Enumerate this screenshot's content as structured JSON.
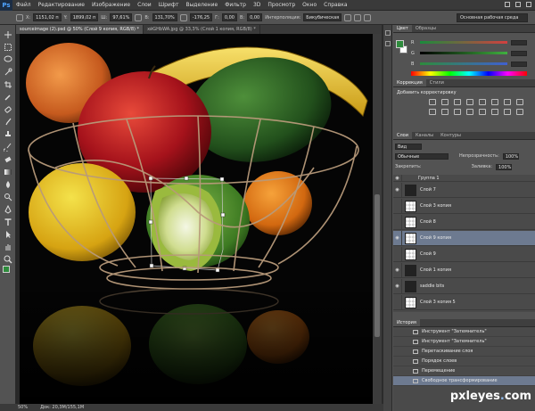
{
  "app": {
    "logo": "Ps"
  },
  "menu": [
    "Файл",
    "Редактирование",
    "Изображение",
    "Слои",
    "Шрифт",
    "Выделение",
    "Фильтр",
    "3D",
    "Просмотр",
    "Окно",
    "Справка"
  ],
  "options": {
    "x_label": "X:",
    "x_value": "1151,02 п",
    "y_label": "Y:",
    "y_value": "1899,02 п",
    "w_label": "Ш:",
    "w_value": "97,61%",
    "h_label": "В:",
    "h_value": "131,70%",
    "angle_value": "-176,25",
    "hskew_label": "Г:",
    "hskew_value": "0,00",
    "vskew_label": "В:",
    "vskew_value": "0,00",
    "interp_label": "Интерполяция:",
    "interp_value": "Бикубическая",
    "workspace": "Основная рабочая среда"
  },
  "tabs": [
    {
      "label": "sourceimage (2).psd @ 50% (Слой 9 копия, RGB/8) *",
      "active": true
    },
    {
      "label": "хйGНbWA.jpg @ 33,3% (Слой 1 копия, RGB/8) *",
      "active": false
    }
  ],
  "status": {
    "zoom": "50%",
    "doc": "Док: 20,3M/155,1M"
  },
  "color_panel": {
    "tabs": [
      "Цвет",
      "Образцы"
    ],
    "channels": [
      {
        "label": "R",
        "value": "",
        "color": "#d24040"
      },
      {
        "label": "G",
        "value": "",
        "color": "#40b040"
      },
      {
        "label": "B",
        "value": "",
        "color": "#4060d0"
      }
    ],
    "fg_color": "#2e8b3c",
    "bg_color": "#ffffff"
  },
  "adjustments": {
    "tabs": [
      "Коррекция",
      "Стили"
    ],
    "title": "Добавить корректировку"
  },
  "layers_panel": {
    "tabs": [
      "Слои",
      "Каналы",
      "Контуры"
    ],
    "kind_label": "Вид",
    "blend_mode": "Обычные",
    "opacity_label": "Непрозрачность:",
    "opacity_value": "100%",
    "lock_label": "Закрепить:",
    "fill_label": "Заливка:",
    "fill_value": "100%",
    "layers": [
      {
        "name": "Группа 1",
        "type": "group",
        "visible": true
      },
      {
        "name": "Слой 7",
        "visible": true,
        "thumb": "dark"
      },
      {
        "name": "Слой 3 копия",
        "visible": false,
        "thumb": "trans"
      },
      {
        "name": "Слой 8",
        "visible": false,
        "thumb": "trans"
      },
      {
        "name": "Слой 9 копия",
        "visible": true,
        "thumb": "trans",
        "selected": true
      },
      {
        "name": "Слой 9",
        "visible": false,
        "thumb": "trans"
      },
      {
        "name": "Слой 1 копия",
        "visible": true,
        "thumb": "dark"
      },
      {
        "name": "saddle bits",
        "visible": true,
        "thumb": "dark"
      },
      {
        "name": "Слой 3 копия 5",
        "visible": false,
        "thumb": "trans"
      }
    ]
  },
  "history": {
    "tabs": [
      "История"
    ],
    "items": [
      {
        "label": "Инструмент \"Затемнитель\""
      },
      {
        "label": "Инструмент \"Затемнитель\""
      },
      {
        "label": "Перетаскивание слоя"
      },
      {
        "label": "Порядок слоев"
      },
      {
        "label": "Перемещение"
      },
      {
        "label": "Свободное трансформирование",
        "selected": true
      }
    ]
  },
  "watermark": {
    "text": "pxleyes",
    "dot": ".",
    "tld": "com"
  }
}
